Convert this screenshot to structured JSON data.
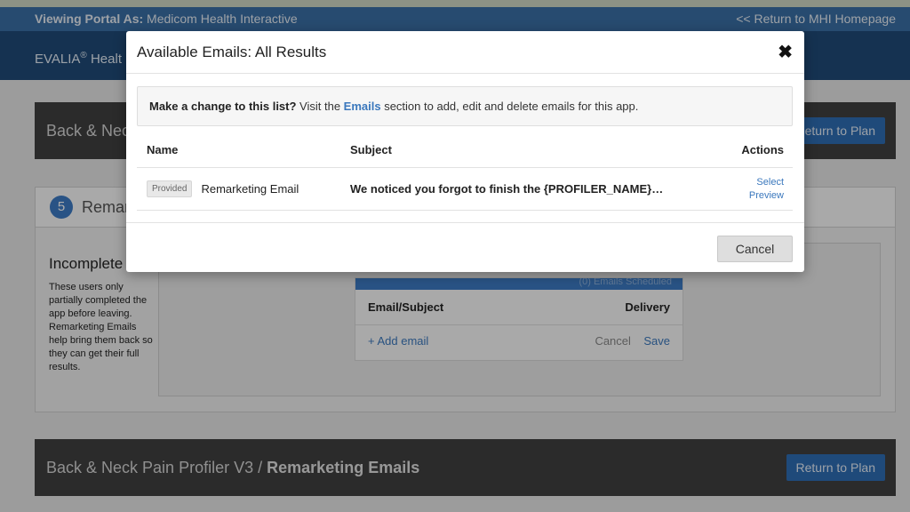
{
  "portal": {
    "viewing_label": "Viewing Portal As:",
    "viewing_org": "Medicom Health Interactive",
    "return_link": "<< Return to MHI Homepage"
  },
  "app_header": {
    "brand": "EVALIA",
    "brand_mark": "®",
    "brand_rest": "Healt"
  },
  "top_bar": {
    "crumb_partial": "Back & Neck",
    "return_button": "Return to Plan"
  },
  "step": {
    "number": "5",
    "title_partial": "Remar",
    "side_title": "Incomplete",
    "side_text": "These users only partially completed the app before leaving. Remarketing Emails help bring them back so they can get their full results.",
    "strip_text": "(0) Emails Scheduled",
    "table": {
      "col_email": "Email/Subject",
      "col_delivery": "Delivery",
      "add_email": "+ Add email",
      "cancel": "Cancel",
      "save": "Save"
    }
  },
  "bottom_bar": {
    "crumb_app": "Back & Neck Pain Profiler V3",
    "crumb_sep": "/",
    "crumb_current": "Remarketing Emails",
    "return_button": "Return to Plan"
  },
  "modal": {
    "title": "Available Emails: All Results",
    "close_glyph": "✖",
    "notice_bold": "Make a change to this list?",
    "notice_pre": " Visit the ",
    "notice_link": "Emails",
    "notice_post": " section to add, edit and delete emails for this app.",
    "columns": {
      "name": "Name",
      "subject": "Subject",
      "actions": "Actions"
    },
    "rows": [
      {
        "badge": "Provided",
        "name": "Remarketing Email",
        "subject": "We noticed you forgot to finish the {PROFILER_NAME}…",
        "action_select": "Select",
        "action_preview": "Preview"
      }
    ],
    "cancel_button": "Cancel"
  },
  "colors": {
    "portal_bar": "#3a6fa6",
    "app_header": "#1f4a78",
    "accent_blue": "#3b78bd",
    "dark_bar": "#404040"
  }
}
